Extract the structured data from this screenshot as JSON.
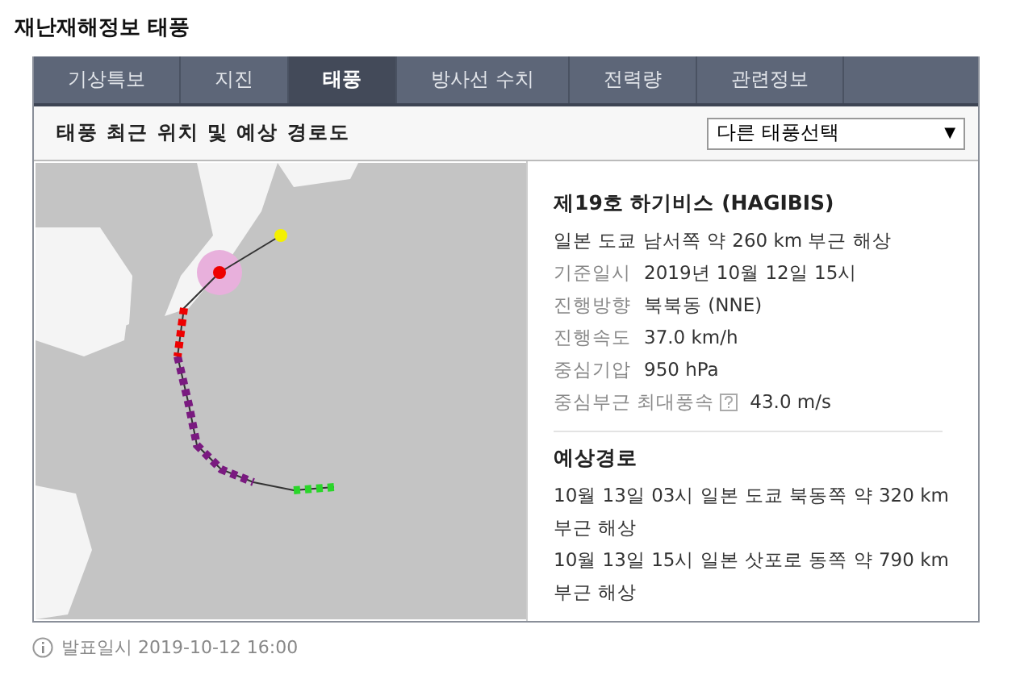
{
  "page_title": "재난재해정보 태풍",
  "tabs": [
    {
      "label": "기상특보",
      "selected": false
    },
    {
      "label": "지진",
      "selected": false
    },
    {
      "label": "태풍",
      "selected": true
    },
    {
      "label": "방사선 수치",
      "selected": false
    },
    {
      "label": "전력량",
      "selected": false
    },
    {
      "label": "관련정보",
      "selected": false
    }
  ],
  "section_title": "태풍 최근 위치 및 예상 경로도",
  "typhoon_select": {
    "value": "다른 태풍선택",
    "arrow": "▼"
  },
  "typhoon": {
    "name": "제19호 하기비스 (HAGIBIS)",
    "location": "일본 도쿄 남서쪽 약 260 km 부근 해상",
    "details": [
      {
        "label": "기준일시",
        "value": "2019년 10월 12일 15시",
        "help": false
      },
      {
        "label": "진행방향",
        "value": "북북동 (NNE)",
        "help": false
      },
      {
        "label": "진행속도",
        "value": "37.0 km/h",
        "help": false
      },
      {
        "label": "중심기압",
        "value": "950 hPa",
        "help": false
      },
      {
        "label": "중심부근 최대풍속",
        "value": "43.0 m/s",
        "help": true
      }
    ]
  },
  "forecast": {
    "title": "예상경로",
    "items": [
      "10월 13일 03시 일본 도쿄 북동쪽 약 320 km 부근 해상",
      "10월 13일 15시 일본 삿포로 동쪽 약 790 km 부근 해상"
    ]
  },
  "footer": {
    "text": "발표일시 2019-10-12 16:00"
  }
}
